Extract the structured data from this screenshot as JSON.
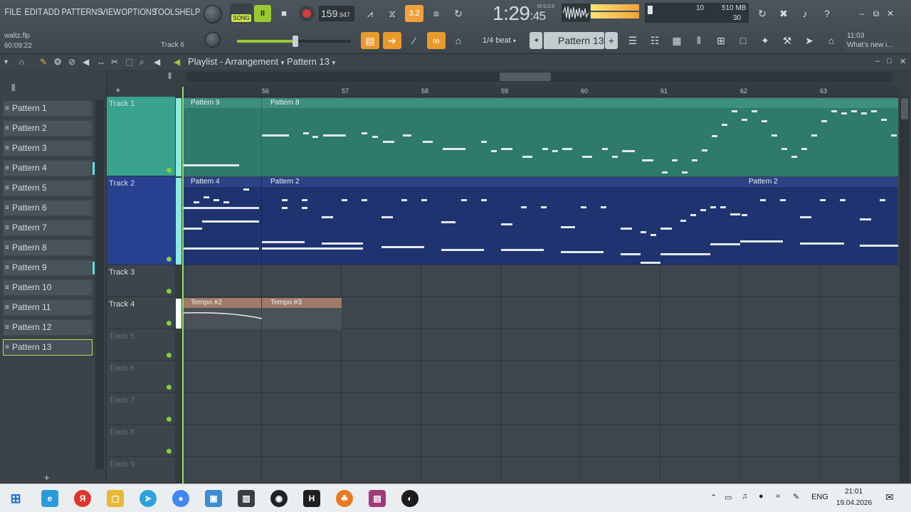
{
  "menu": [
    "FILE",
    "EDIT",
    "ADD",
    "PATTERNS",
    "VIEW",
    "OPTIONS",
    "TOOLS",
    "HELP"
  ],
  "file": {
    "name": "waltz.flp",
    "time": "60:09:22",
    "track_hint": "Track 6"
  },
  "transport": {
    "song_label": "SONG",
    "pause": "II",
    "stop": "■",
    "tempo_main": "159",
    "tempo_dec": ".947",
    "clock_main": "1:29",
    "clock_sub": ":45",
    "clock_unit": "M:S:CS"
  },
  "cpu": {
    "left": "10",
    "mem": "510 MB",
    "poly": "30"
  },
  "toolbar2": {
    "snap": "1/4 beat",
    "pattern": "Pattern 13"
  },
  "hint": {
    "time": "11:03",
    "text": "What's new i..."
  },
  "playlist": {
    "title": "Playlist - Arrangement",
    "pattern": "Pattern 13"
  },
  "ruler": [
    "56",
    "57",
    "58",
    "59",
    "60",
    "61",
    "62",
    "63"
  ],
  "patterns": [
    "Pattern 1",
    "Pattern 2",
    "Pattern 3",
    "Pattern 4",
    "Pattern 5",
    "Pattern 6",
    "Pattern 7",
    "Pattern 8",
    "Pattern 9",
    "Pattern 10",
    "Pattern 11",
    "Pattern 12",
    "Pattern 13"
  ],
  "tracks": [
    {
      "name": "Track 1"
    },
    {
      "name": "Track 2"
    },
    {
      "name": "Track 3"
    },
    {
      "name": "Track 4"
    },
    {
      "name": "Track 5"
    },
    {
      "name": "Track 6"
    },
    {
      "name": "Track 7"
    },
    {
      "name": "Track 8"
    },
    {
      "name": "Track 9"
    }
  ],
  "clips": {
    "t1a": "Pattern 9",
    "t1b": "Pattern 8",
    "t2a": "Pattern 4",
    "t2b": "Pattern 2",
    "t2c": "Pattern 2",
    "t4a": "Tempo #2",
    "t4b": "Tempo #3"
  },
  "taskbar": {
    "lang": "ENG",
    "time": "21:01",
    "date": "19.04.2026"
  },
  "colors": {
    "track1": "#2e7a6c",
    "track2": "#1f3370",
    "accent": "#9bc832"
  }
}
